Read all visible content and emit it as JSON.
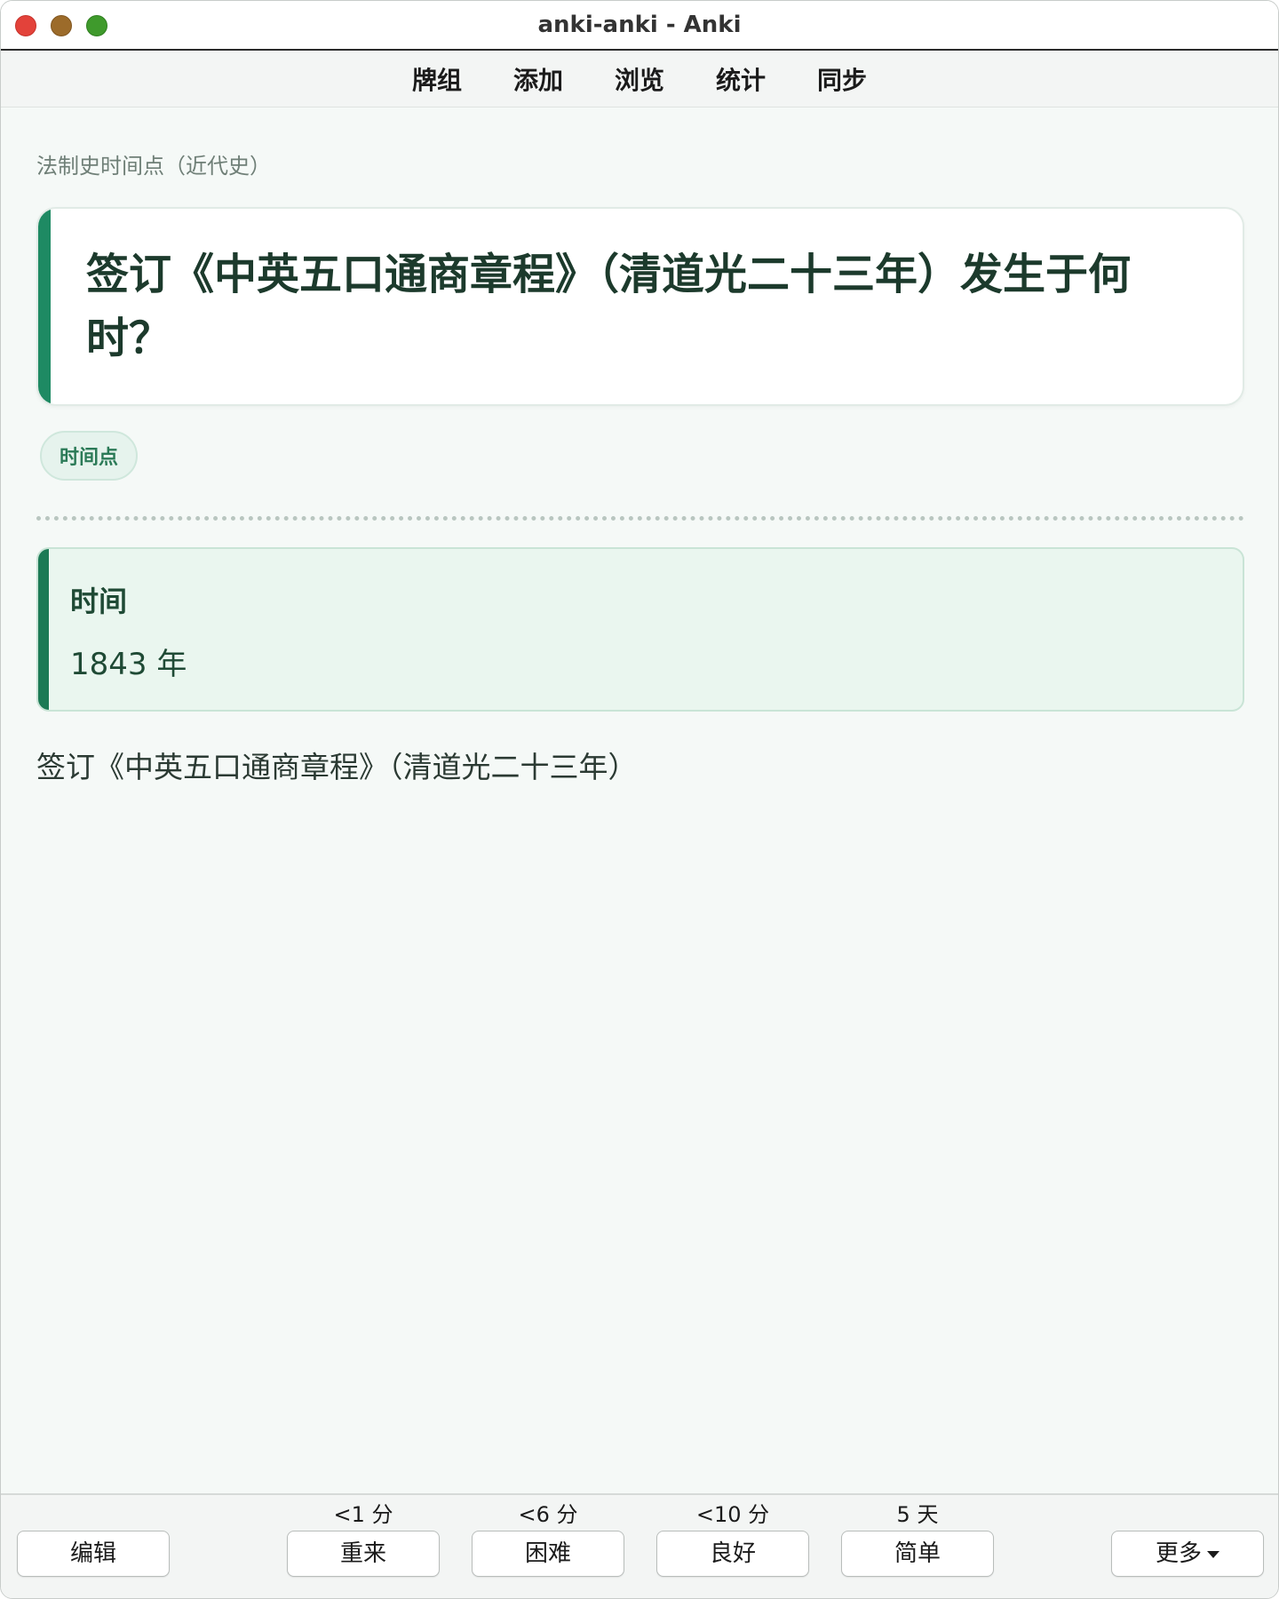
{
  "window": {
    "title": "anki-anki - Anki"
  },
  "toolbar": {
    "items": [
      {
        "label": "牌组"
      },
      {
        "label": "添加"
      },
      {
        "label": "浏览"
      },
      {
        "label": "统计"
      },
      {
        "label": "同步"
      }
    ]
  },
  "card": {
    "deck_name": "法制史时间点（近代史）",
    "question": "签订《中英五口通商章程》（清道光二十三年）发生于何时？",
    "tag": "时间点",
    "answer_label": "时间",
    "answer_value": "1843 年",
    "answer_extra": "签订《中英五口通商章程》（清道光二十三年）"
  },
  "bottom": {
    "edit_label": "编辑",
    "more_label": "更多",
    "ease_buttons": [
      {
        "label": "重来",
        "interval": "<1 分"
      },
      {
        "label": "困难",
        "interval": "<6 分"
      },
      {
        "label": "良好",
        "interval": "<10 分"
      },
      {
        "label": "简单",
        "interval": "5 天"
      }
    ]
  }
}
